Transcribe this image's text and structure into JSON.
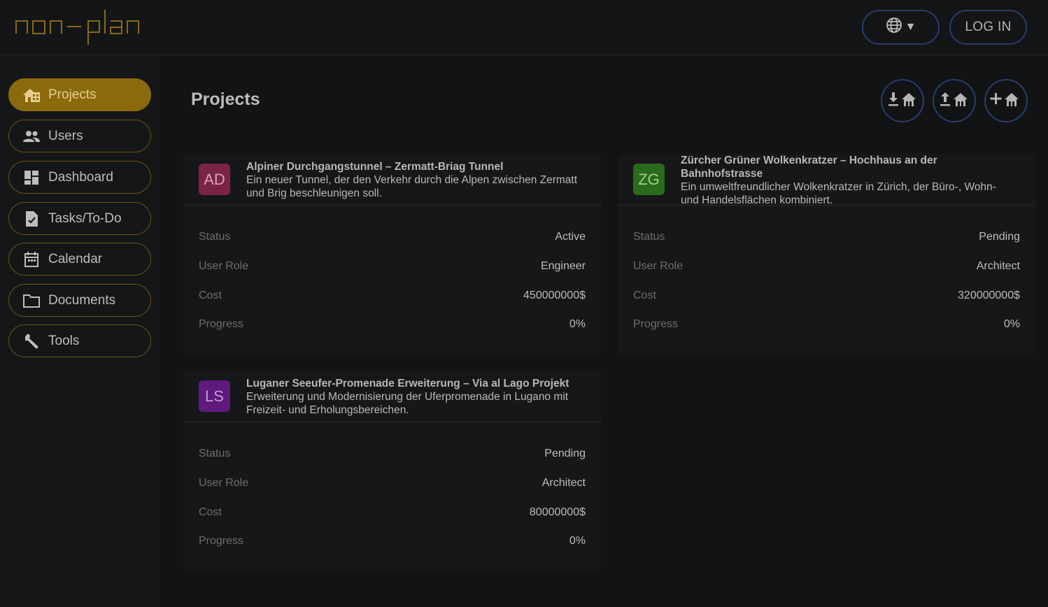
{
  "header": {
    "logo_text": "non-plan",
    "lang_button_icon": "globe-icon",
    "lang_caret": "▼",
    "login_label": "LOG IN"
  },
  "sidebar": {
    "items": [
      {
        "label": "Projects",
        "icon": "house-icon",
        "active": true
      },
      {
        "label": "Users",
        "icon": "users-icon",
        "active": false
      },
      {
        "label": "Dashboard",
        "icon": "dashboard-icon",
        "active": false
      },
      {
        "label": "Tasks/To-Do",
        "icon": "task-icon",
        "active": false
      },
      {
        "label": "Calendar",
        "icon": "calendar-icon",
        "active": false
      },
      {
        "label": "Documents",
        "icon": "folder-icon",
        "active": false
      },
      {
        "label": "Tools",
        "icon": "wrench-icon",
        "active": false
      }
    ]
  },
  "main": {
    "title": "Projects",
    "actions": [
      {
        "icon": "download-house-icon"
      },
      {
        "icon": "upload-house-icon"
      },
      {
        "icon": "add-house-icon",
        "plus": "+"
      }
    ],
    "labels": {
      "status": "Status",
      "role": "User Role",
      "cost": "Cost",
      "progress": "Progress"
    },
    "projects": [
      {
        "initials": "AD",
        "avatar_color": "#7a2346",
        "title": "Alpiner Durchgangstunnel – Zermatt-Briag Tunnel",
        "description": "Ein neuer Tunnel, der den Verkehr durch die Alpen zwischen Zermatt und Brig beschleunigen soll.",
        "status": "Active",
        "role": "Engineer",
        "cost": "450000000$",
        "progress": "0%"
      },
      {
        "initials": "ZG",
        "avatar_color": "#2a6a1c",
        "title": "Zürcher Grüner Wolkenkratzer – Hochhaus an der Bahnhofstrasse",
        "description": "Ein umweltfreundlicher Wolkenkratzer in Zürich, der Büro-, Wohn- und Handelsflächen kombiniert.",
        "status": "Pending",
        "role": "Architect",
        "cost": "320000000$",
        "progress": "0%"
      },
      {
        "initials": "LS",
        "avatar_color": "#5e1a7c",
        "title": "Luganer Seeufer-Promenade Erweiterung – Via al Lago Projekt",
        "description": "Erweiterung und Modernisierung der Uferpromenade in Lugano mit Freizeit- und Erholungsbereichen.",
        "status": "Pending",
        "role": "Architect",
        "cost": "80000000$",
        "progress": "0%"
      }
    ]
  },
  "colors": {
    "accent": "#8b6a0d",
    "button_border": "#263d6e",
    "background": "#131415"
  }
}
